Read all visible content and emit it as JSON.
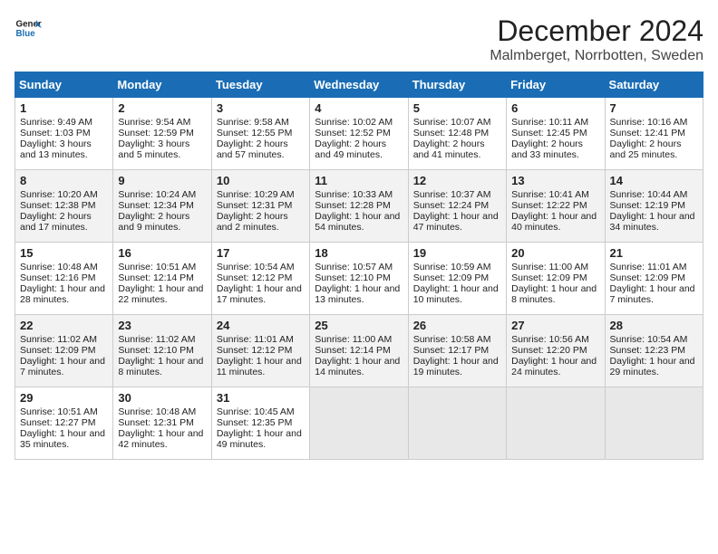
{
  "logo": {
    "line1": "General",
    "line2": "Blue"
  },
  "title": "December 2024",
  "subtitle": "Malmberget, Norrbotten, Sweden",
  "days_of_week": [
    "Sunday",
    "Monday",
    "Tuesday",
    "Wednesday",
    "Thursday",
    "Friday",
    "Saturday"
  ],
  "weeks": [
    [
      {
        "day": "1",
        "info": "Sunrise: 9:49 AM\nSunset: 1:03 PM\nDaylight: 3 hours and 13 minutes."
      },
      {
        "day": "2",
        "info": "Sunrise: 9:54 AM\nSunset: 12:59 PM\nDaylight: 3 hours and 5 minutes."
      },
      {
        "day": "3",
        "info": "Sunrise: 9:58 AM\nSunset: 12:55 PM\nDaylight: 2 hours and 57 minutes."
      },
      {
        "day": "4",
        "info": "Sunrise: 10:02 AM\nSunset: 12:52 PM\nDaylight: 2 hours and 49 minutes."
      },
      {
        "day": "5",
        "info": "Sunrise: 10:07 AM\nSunset: 12:48 PM\nDaylight: 2 hours and 41 minutes."
      },
      {
        "day": "6",
        "info": "Sunrise: 10:11 AM\nSunset: 12:45 PM\nDaylight: 2 hours and 33 minutes."
      },
      {
        "day": "7",
        "info": "Sunrise: 10:16 AM\nSunset: 12:41 PM\nDaylight: 2 hours and 25 minutes."
      }
    ],
    [
      {
        "day": "8",
        "info": "Sunrise: 10:20 AM\nSunset: 12:38 PM\nDaylight: 2 hours and 17 minutes."
      },
      {
        "day": "9",
        "info": "Sunrise: 10:24 AM\nSunset: 12:34 PM\nDaylight: 2 hours and 9 minutes."
      },
      {
        "day": "10",
        "info": "Sunrise: 10:29 AM\nSunset: 12:31 PM\nDaylight: 2 hours and 2 minutes."
      },
      {
        "day": "11",
        "info": "Sunrise: 10:33 AM\nSunset: 12:28 PM\nDaylight: 1 hour and 54 minutes."
      },
      {
        "day": "12",
        "info": "Sunrise: 10:37 AM\nSunset: 12:24 PM\nDaylight: 1 hour and 47 minutes."
      },
      {
        "day": "13",
        "info": "Sunrise: 10:41 AM\nSunset: 12:22 PM\nDaylight: 1 hour and 40 minutes."
      },
      {
        "day": "14",
        "info": "Sunrise: 10:44 AM\nSunset: 12:19 PM\nDaylight: 1 hour and 34 minutes."
      }
    ],
    [
      {
        "day": "15",
        "info": "Sunrise: 10:48 AM\nSunset: 12:16 PM\nDaylight: 1 hour and 28 minutes."
      },
      {
        "day": "16",
        "info": "Sunrise: 10:51 AM\nSunset: 12:14 PM\nDaylight: 1 hour and 22 minutes."
      },
      {
        "day": "17",
        "info": "Sunrise: 10:54 AM\nSunset: 12:12 PM\nDaylight: 1 hour and 17 minutes."
      },
      {
        "day": "18",
        "info": "Sunrise: 10:57 AM\nSunset: 12:10 PM\nDaylight: 1 hour and 13 minutes."
      },
      {
        "day": "19",
        "info": "Sunrise: 10:59 AM\nSunset: 12:09 PM\nDaylight: 1 hour and 10 minutes."
      },
      {
        "day": "20",
        "info": "Sunrise: 11:00 AM\nSunset: 12:09 PM\nDaylight: 1 hour and 8 minutes."
      },
      {
        "day": "21",
        "info": "Sunrise: 11:01 AM\nSunset: 12:09 PM\nDaylight: 1 hour and 7 minutes."
      }
    ],
    [
      {
        "day": "22",
        "info": "Sunrise: 11:02 AM\nSunset: 12:09 PM\nDaylight: 1 hour and 7 minutes."
      },
      {
        "day": "23",
        "info": "Sunrise: 11:02 AM\nSunset: 12:10 PM\nDaylight: 1 hour and 8 minutes."
      },
      {
        "day": "24",
        "info": "Sunrise: 11:01 AM\nSunset: 12:12 PM\nDaylight: 1 hour and 11 minutes."
      },
      {
        "day": "25",
        "info": "Sunrise: 11:00 AM\nSunset: 12:14 PM\nDaylight: 1 hour and 14 minutes."
      },
      {
        "day": "26",
        "info": "Sunrise: 10:58 AM\nSunset: 12:17 PM\nDaylight: 1 hour and 19 minutes."
      },
      {
        "day": "27",
        "info": "Sunrise: 10:56 AM\nSunset: 12:20 PM\nDaylight: 1 hour and 24 minutes."
      },
      {
        "day": "28",
        "info": "Sunrise: 10:54 AM\nSunset: 12:23 PM\nDaylight: 1 hour and 29 minutes."
      }
    ],
    [
      {
        "day": "29",
        "info": "Sunrise: 10:51 AM\nSunset: 12:27 PM\nDaylight: 1 hour and 35 minutes."
      },
      {
        "day": "30",
        "info": "Sunrise: 10:48 AM\nSunset: 12:31 PM\nDaylight: 1 hour and 42 minutes."
      },
      {
        "day": "31",
        "info": "Sunrise: 10:45 AM\nSunset: 12:35 PM\nDaylight: 1 hour and 49 minutes."
      },
      {
        "day": "",
        "info": ""
      },
      {
        "day": "",
        "info": ""
      },
      {
        "day": "",
        "info": ""
      },
      {
        "day": "",
        "info": ""
      }
    ]
  ]
}
